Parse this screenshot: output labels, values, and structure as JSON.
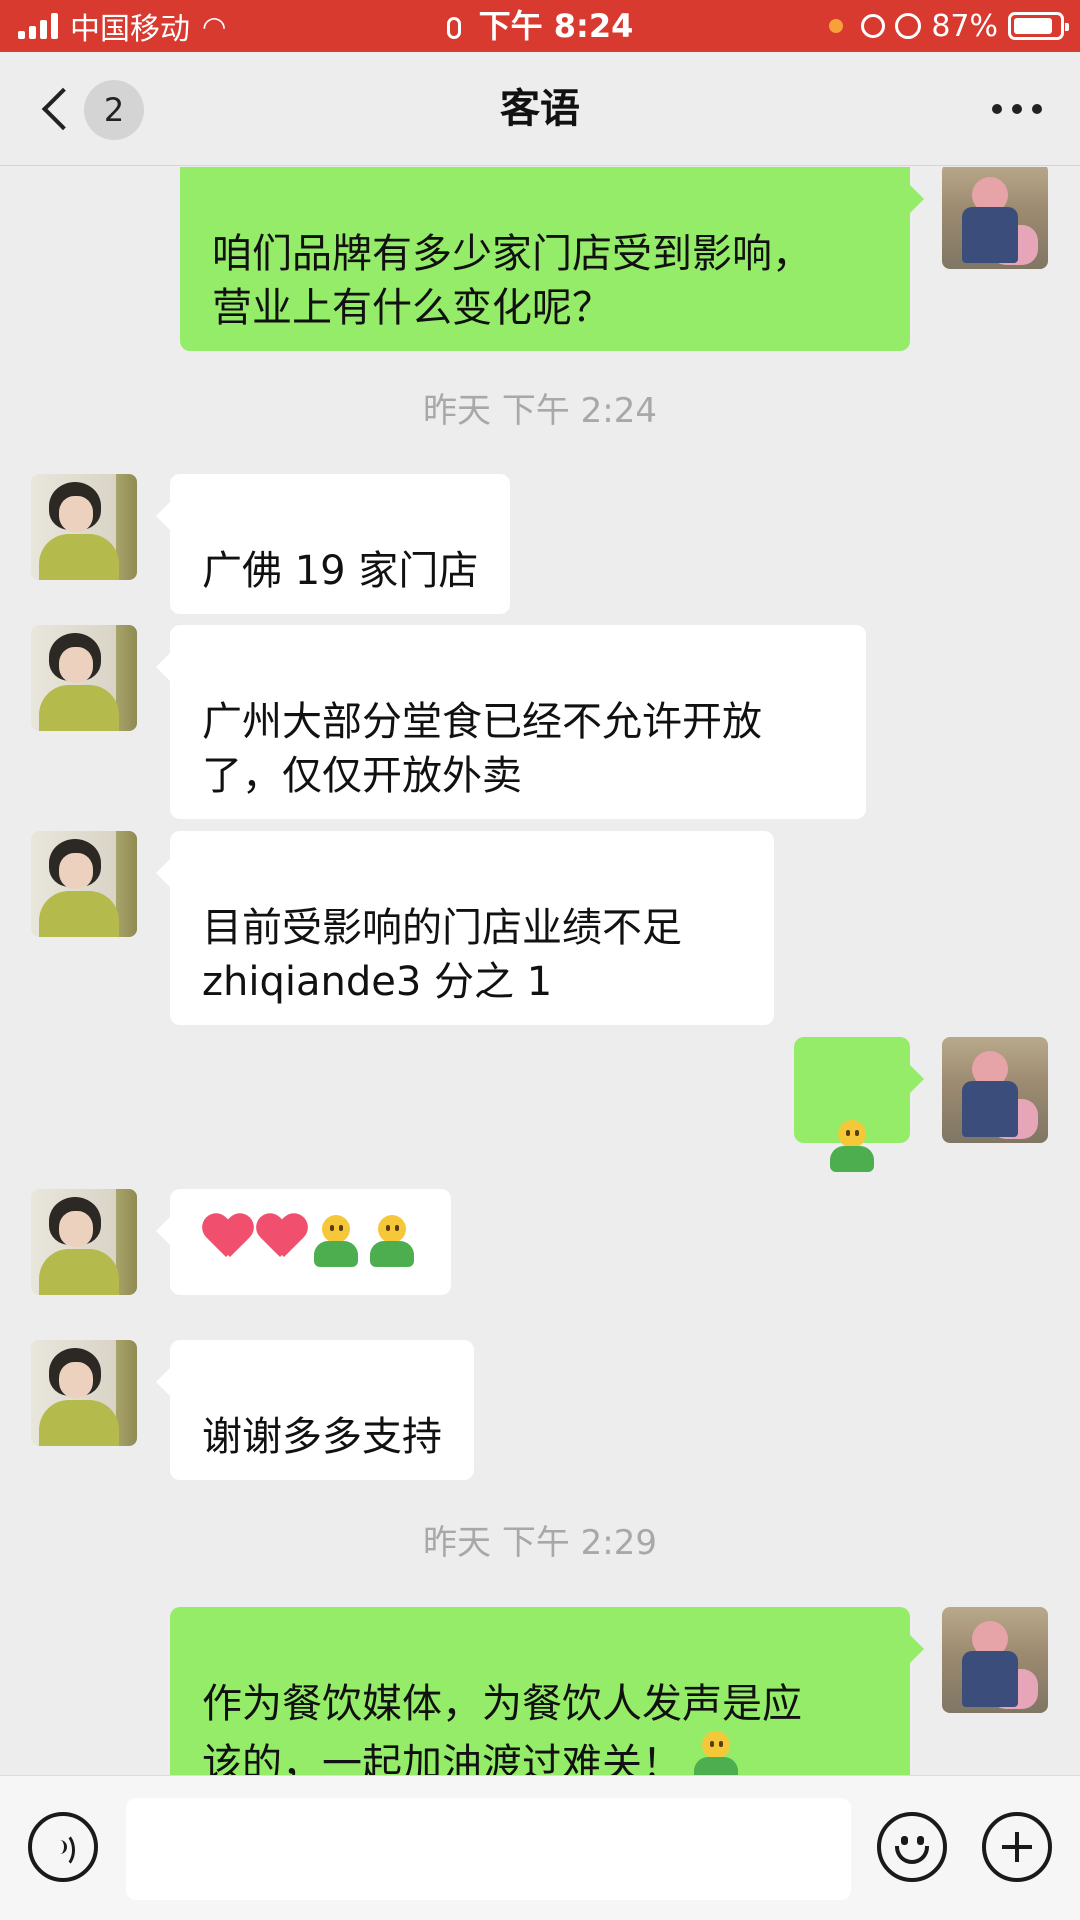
{
  "status_bar": {
    "carrier": "中国移动",
    "time": "下午 8:24",
    "battery": "87%",
    "battery_level": 0.87
  },
  "nav": {
    "unread_count": "2",
    "title": "客语"
  },
  "messages": [
    {
      "type": "text",
      "from": "me",
      "text": "咱们品牌有多少家门店受到影响，\n营业上有什么变化呢？"
    },
    {
      "type": "time",
      "text": "昨天 下午 2:24"
    },
    {
      "type": "text",
      "from": "other",
      "text": "广佛 19 家门店"
    },
    {
      "type": "text",
      "from": "other",
      "text": "广州大部分堂食已经不允许开放\n了，仅仅开放外卖"
    },
    {
      "type": "text",
      "from": "other",
      "text": "目前受影响的门店业绩不足\nzhiqiande3 分之 1"
    },
    {
      "type": "emoji",
      "from": "me",
      "emojis": [
        "guy-emoji"
      ]
    },
    {
      "type": "emoji",
      "from": "other",
      "emojis": [
        "heart-emoji",
        "heart-emoji",
        "guy-emoji",
        "guy-emoji"
      ]
    },
    {
      "type": "text",
      "from": "other",
      "text": "谢谢多多支持"
    },
    {
      "type": "time",
      "text": "昨天 下午 2:29"
    },
    {
      "type": "text",
      "from": "me",
      "text": "作为餐饮媒体，为餐饮人发声是应\n该的，一起加油渡过难关！",
      "trailing_emoji": "guy-emoji"
    }
  ],
  "input_bar": {
    "icons": [
      "voice-icon",
      "emoji-icon",
      "plus-icon"
    ]
  },
  "colors": {
    "status_bar": "#d93a30",
    "background": "#ededed",
    "my_bubble": "#95ec69",
    "their_bubble": "#ffffff"
  }
}
